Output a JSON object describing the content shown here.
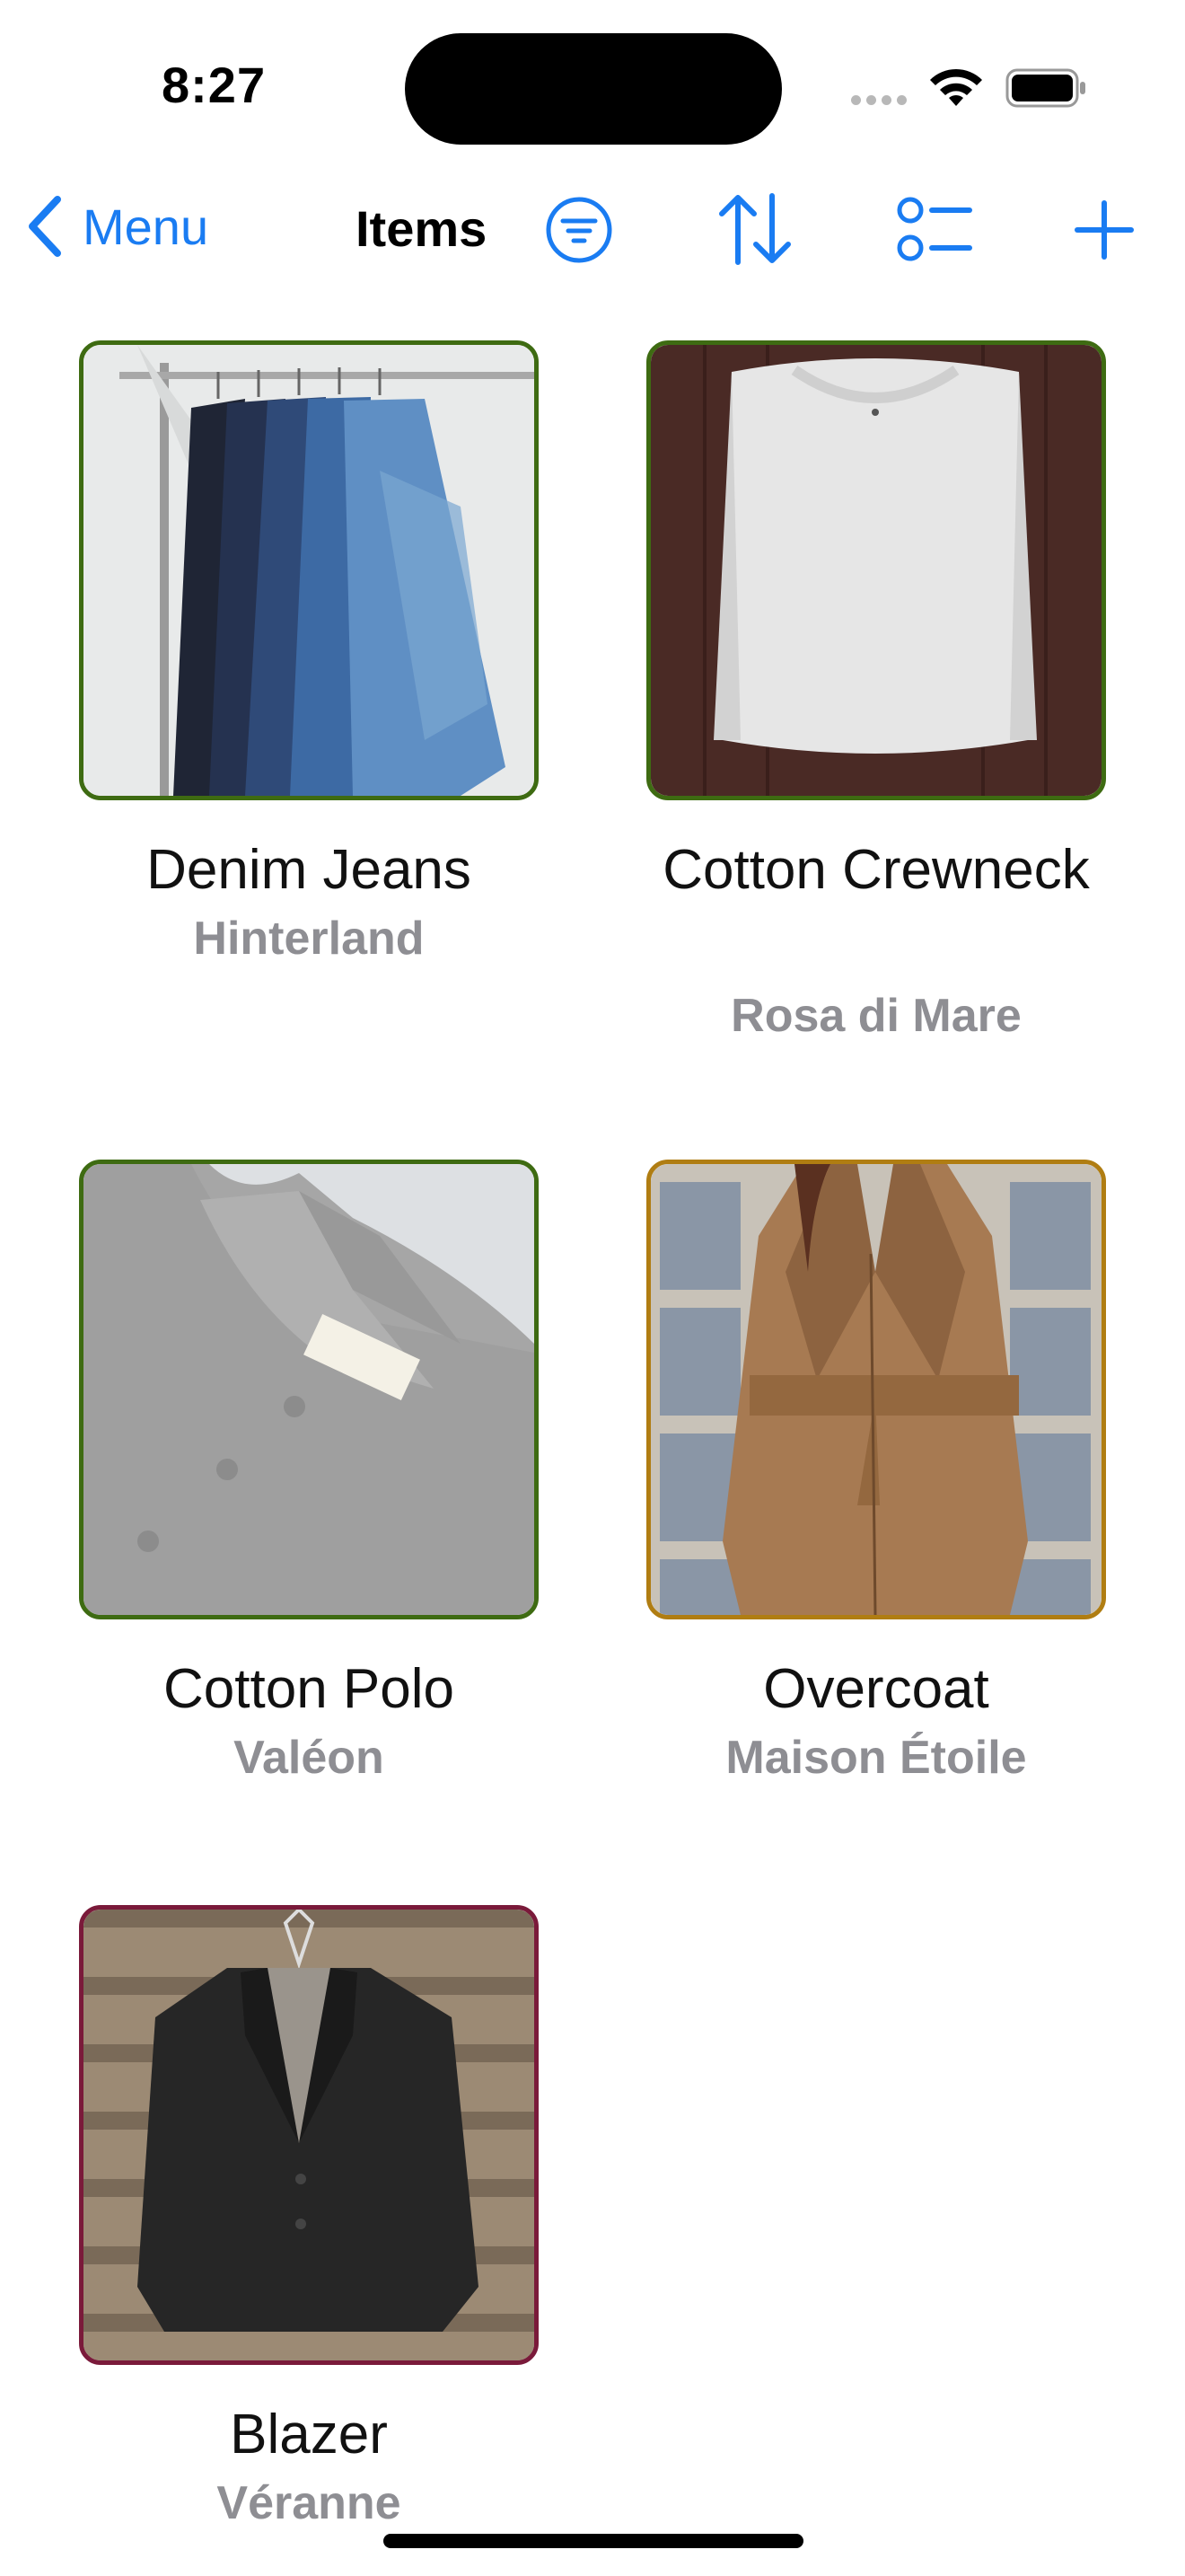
{
  "status": {
    "time": "8:27"
  },
  "nav": {
    "back_label": "Menu",
    "title": "Items",
    "accent": "#1a7cf2",
    "icons": [
      "filter-icon",
      "sort-icon",
      "list-icon",
      "plus-icon"
    ]
  },
  "items": [
    {
      "name": "Denim Jeans",
      "brand": "Hinterland",
      "border_color": "#3e6b12"
    },
    {
      "name": "Cotton Crewneck",
      "brand": "Rosa di Mare",
      "border_color": "#3e6b12"
    },
    {
      "name": "Cotton Polo",
      "brand": "Valéon",
      "border_color": "#3e6b12"
    },
    {
      "name": "Overcoat",
      "brand": "Maison Étoile",
      "border_color": "#b07d12"
    },
    {
      "name": "Blazer",
      "brand": "Véranne",
      "border_color": "#7a1a3a"
    }
  ]
}
